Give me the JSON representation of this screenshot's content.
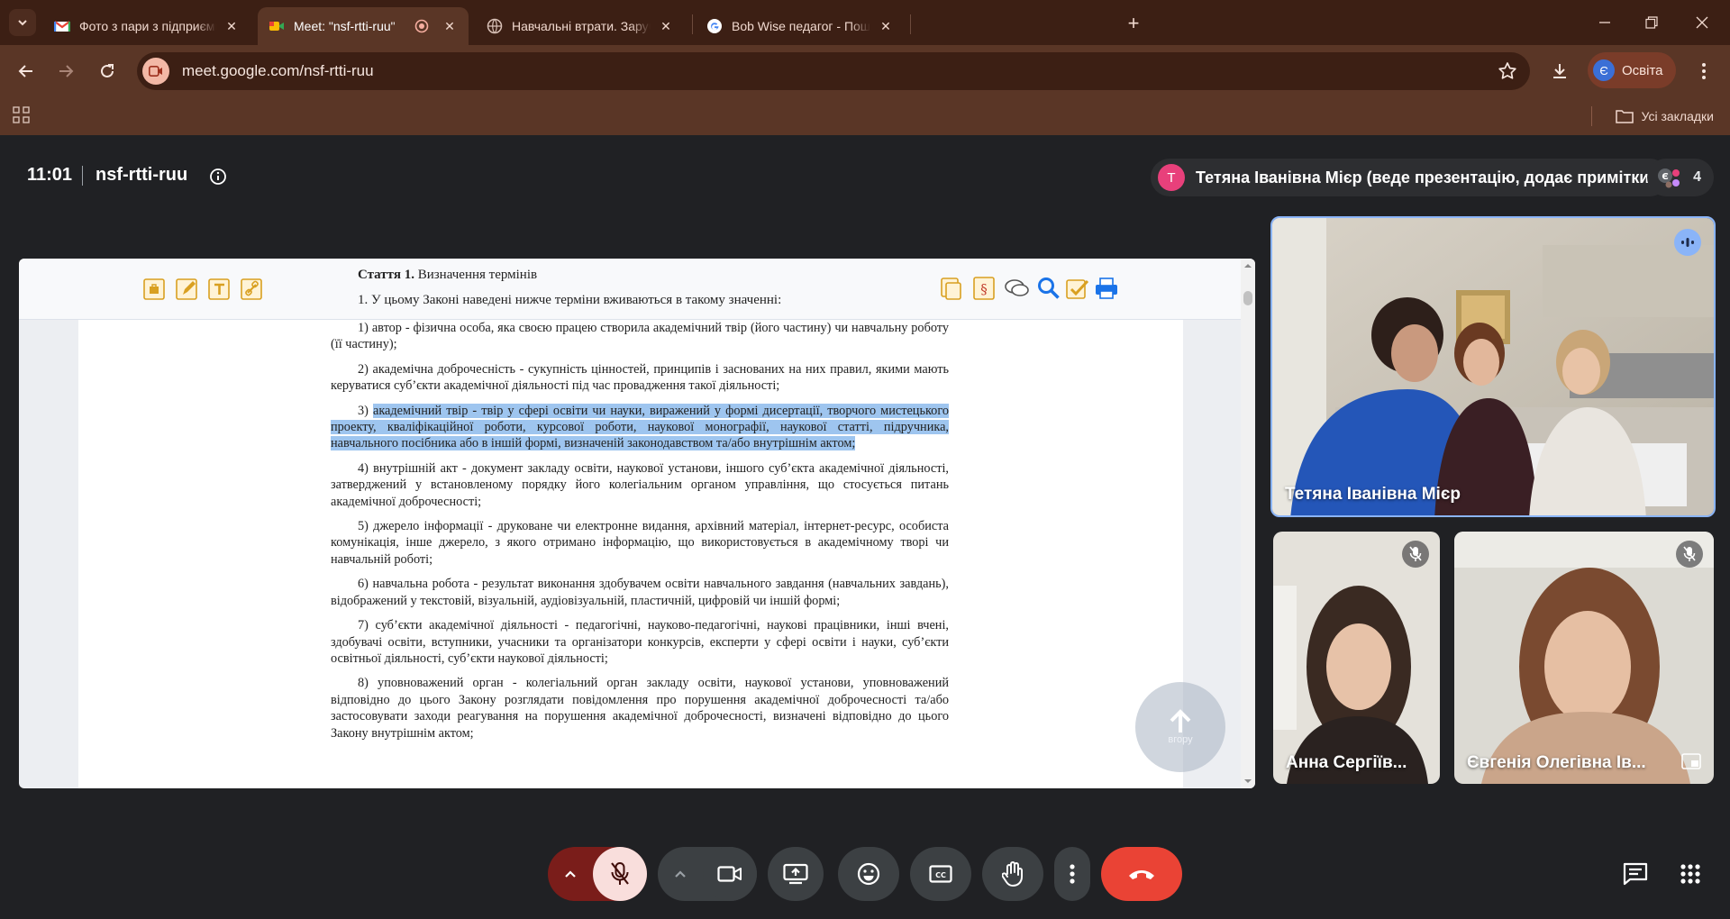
{
  "browser": {
    "tabs": [
      {
        "title": "Фото з пари з підприємцем - у",
        "icon": "gmail-icon"
      },
      {
        "title": "Meet: \"nsf-rtti-ruu\"",
        "icon": "meet-icon"
      },
      {
        "title": "Навчальні втрати. Зарубіжні ка",
        "icon": "globe-icon"
      },
      {
        "title": "Bob Wise педагог - Пошук Goo",
        "icon": "google-icon"
      }
    ],
    "url": "meet.google.com/nsf-rtti-ruu",
    "profile_initial": "Є",
    "profile_label": "Освіта",
    "all_bookmarks": "Усі закладки"
  },
  "meet": {
    "time": "11:01",
    "code": "nsf-rtti-ruu",
    "presenter_initial": "T",
    "presenter_label": "Тетяна Іванівна Мієр (веде презентацію, додає примітки)",
    "people_count": "4",
    "participants": [
      {
        "name": "Тетяна Іванівна Мієр",
        "muted": false,
        "speaking": true
      },
      {
        "name": "Анна Сергіїв...",
        "muted": true
      },
      {
        "name": "Євгенія Олегівна Ів...",
        "muted": true
      }
    ],
    "up_button_label": "вгору"
  },
  "document": {
    "article_number": "Стаття 1.",
    "article_title": "Визначення термінів",
    "intro": "1. У цьому Законі наведені нижче терміни вживаються в такому значенні:",
    "paragraphs": [
      {
        "num": "1)",
        "text": "автор - фізична особа, яка своєю працею створила академічний твір (його частину) чи навчальну роботу (її частину);"
      },
      {
        "num": "2)",
        "text": "академічна доброчесність - сукупність цінностей, принципів і заснованих на них правил, якими мають керуватися суб’єкти академічної діяльності під час провадження такої діяльності;"
      },
      {
        "num": "3)",
        "text": "академічний твір - твір у сфері освіти чи науки, виражений у формі дисертації, творчого мистецького проекту, кваліфікаційної роботи, курсової роботи, наукової монографії, наукової статті, підручника, навчального посібника або в іншій формі, визначеній законодавством та/або внутрішнім актом;",
        "highlighted": true
      },
      {
        "num": "4)",
        "text": "внутрішній акт - документ закладу освіти, наукової установи, іншого суб’єкта академічної діяльності, затверджений у встановленому порядку його колегіальним органом управління, що стосується питань академічної доброчесності;"
      },
      {
        "num": "5)",
        "text": "джерело інформації - друковане чи електронне видання, архівний матеріал, інтернет-ресурс, особиста комунікація, інше джерело, з якого отримано інформацію, що використовується в академічному творі чи навчальній роботі;"
      },
      {
        "num": "6)",
        "text": "навчальна робота - результат виконання здобувачем освіти навчального завдання (навчальних завдань), відображений у текстовій, візуальній, аудіовізуальній, пластичній, цифровій чи іншій формі;"
      },
      {
        "num": "7)",
        "text": "суб’єкти академічної діяльності - педагогічні, науково-педагогічні, наукові працівники, інші вчені, здобувачі освіти, вступники, учасники та організатори конкурсів, експерти у сфері освіти і науки, суб’єкти освітньої діяльності, суб’єкти наукової діяльності;"
      },
      {
        "num": "8)",
        "text": "уповноважений орган - колегіальний орган закладу освіти, наукової установи, уповноважений відповідно до цього Закону розглядати повідомлення про порушення академічної доброчесності та/або застосовувати заходи реагування на порушення академічної доброчесності, визначені відповідно до цього Закону внутрішнім актом;"
      }
    ]
  },
  "colors": {
    "end_call": "#ea4335",
    "mic_off_bg": "#f9dedc",
    "highlight": "#9ec5ef",
    "speaking": "#8ab4f8"
  }
}
